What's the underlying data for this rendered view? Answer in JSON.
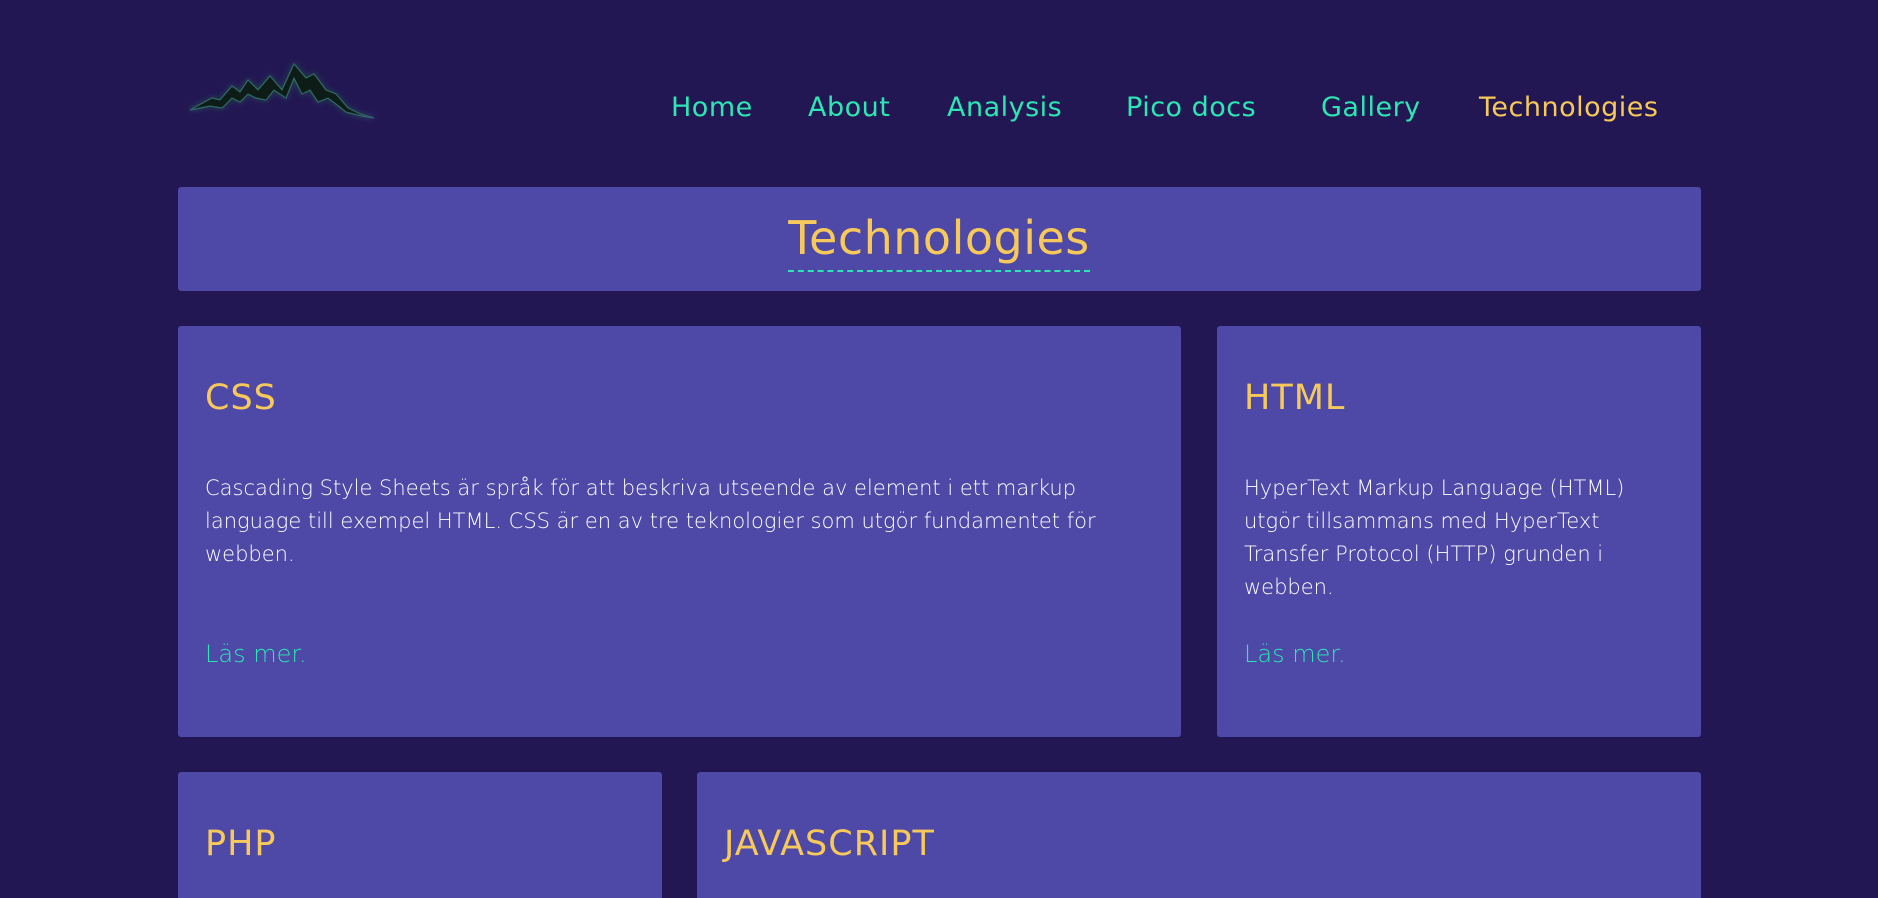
{
  "header": {
    "logo_icon": "mountain-logo-icon",
    "nav": [
      {
        "label": "Home",
        "active": false
      },
      {
        "label": "About",
        "active": false
      },
      {
        "label": "Analysis",
        "active": false
      },
      {
        "label": "Pico docs",
        "active": false
      },
      {
        "label": "Gallery",
        "active": false
      },
      {
        "label": "Technologies",
        "active": true
      }
    ]
  },
  "main": {
    "title": "Technologies",
    "cards": [
      {
        "title": "CSS",
        "text": "Cascading Style Sheets är språk för att beskriva utseende av element i ett markup language till exempel HTML. CSS är en av tre teknologier som utgör fundamentet för webben.",
        "link": "Läs mer."
      },
      {
        "title": "HTML",
        "text": "HyperText Markup Language (HTML) utgör tillsammans med HyperText Transfer Protocol (HTTP) grunden i webben.",
        "link": "Läs mer."
      },
      {
        "title": "PHP"
      },
      {
        "title": "JAVASCRIPT"
      }
    ]
  },
  "colors": {
    "background": "#221753",
    "panel": "#4e48a6",
    "accent_yellow": "#f7c95a",
    "accent_teal": "#2ee6b4",
    "text": "#ffffff"
  }
}
